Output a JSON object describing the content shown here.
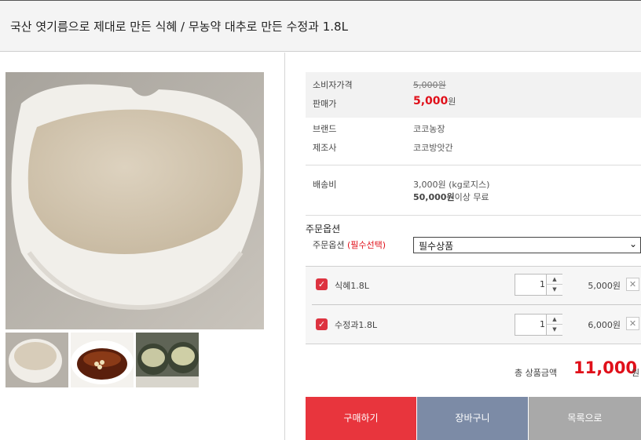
{
  "product": {
    "title": "국산 엿기름으로 제대로 만든 식혜 / 무농약 대추로 만든 수정과 1.8L"
  },
  "info": {
    "consumer_price_label": "소비자가격",
    "consumer_price": "5,000원",
    "sale_price_label": "판매가",
    "sale_price": "5,000",
    "sale_price_unit": "원",
    "brand_label": "브랜드",
    "brand": "코코농장",
    "maker_label": "제조사",
    "maker": "코코방앗간",
    "shipping_label": "배송비",
    "shipping_fee": "3,000원 (kg로지스)",
    "free_shipping_amount": "50,000원",
    "free_shipping_suffix": "이상 무료"
  },
  "order_option": {
    "section_title": "주문옵션",
    "field_label": "주문옵션",
    "required_text": "(필수선택)",
    "selected": "필수상품"
  },
  "selected_items": [
    {
      "name": "식혜1.8L",
      "quantity": "1",
      "price": "5,000원",
      "checked": true
    },
    {
      "name": "수정과1.8L",
      "quantity": "1",
      "price": "6,000원",
      "checked": true
    }
  ],
  "total": {
    "label": "총 상품금액",
    "amount": "11,000",
    "unit": "원"
  },
  "buttons": {
    "buy": "구매하기",
    "cart": "장바구니",
    "list": "목록으로"
  },
  "icons": {
    "checkbox": "checkbox-checked-icon",
    "spinner_up": "arrow-up-icon",
    "spinner_down": "arrow-down-icon",
    "remove": "close-icon",
    "dropdown": "chevron-down-icon"
  },
  "colors": {
    "accent_red": "#e0101a",
    "buy_button": "#e8353d",
    "cart_button": "#7c8ba6",
    "list_button": "#a9a9a9"
  }
}
